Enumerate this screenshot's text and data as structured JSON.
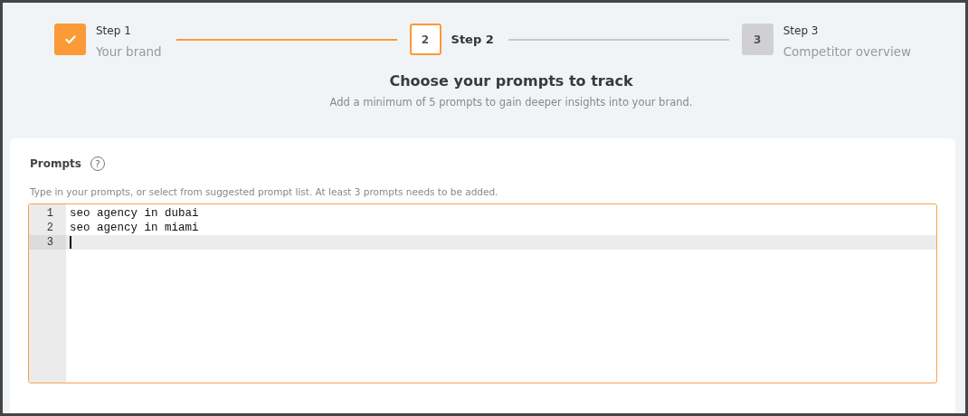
{
  "steps": [
    {
      "label": "Step 1",
      "subtitle": "Your brand",
      "completed": true,
      "selected": false
    },
    {
      "number": "2",
      "label": "Step 2",
      "completed": false,
      "selected": true
    },
    {
      "number": "3",
      "label": "Step 3",
      "subtitle": "Competitor overview",
      "completed": false,
      "selected": false
    }
  ],
  "heading": "Choose your prompts to track",
  "subheading": "Add a minimum of 5 prompts to gain deeper insights into your brand.",
  "prompts": {
    "label": "Prompts",
    "help": "?",
    "hint": "Type in your prompts, or select from suggested prompt list. At least 3 prompts needs to be added.",
    "lines": [
      {
        "number": "1",
        "text": "seo agency in dubai",
        "active": false
      },
      {
        "number": "2",
        "text": "seo agency in miami",
        "active": false
      },
      {
        "number": "3",
        "active": true
      }
    ]
  }
}
